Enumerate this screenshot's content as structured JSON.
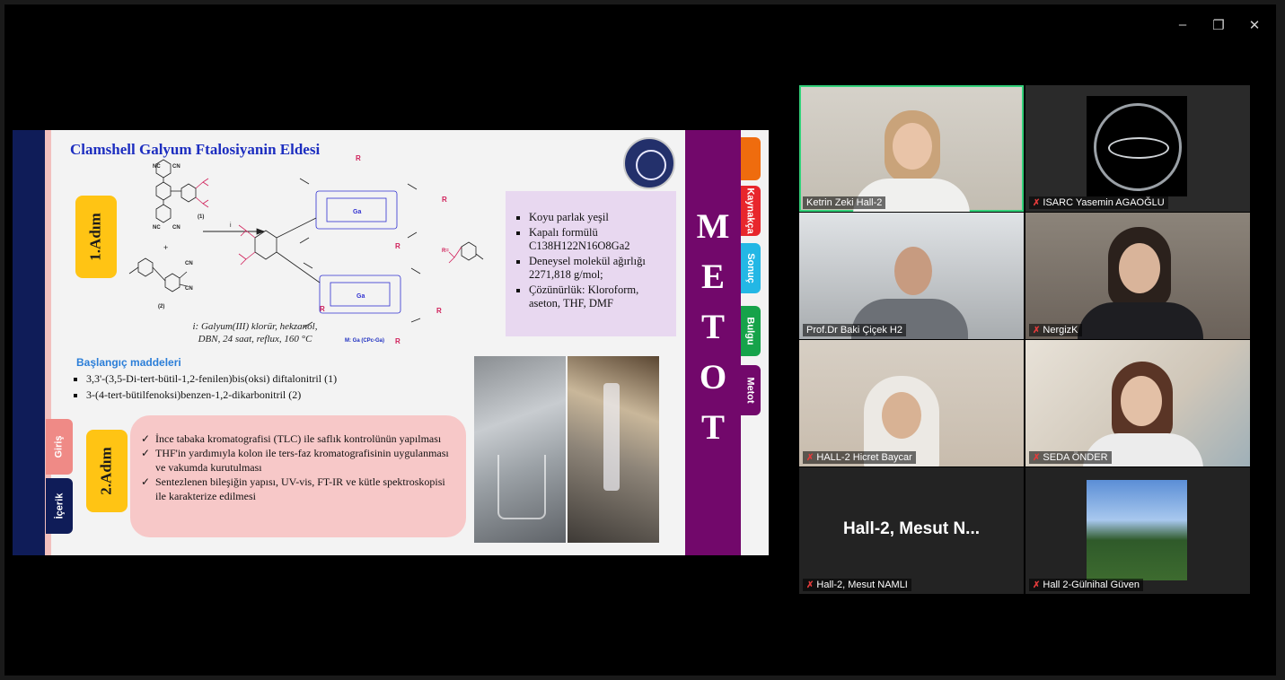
{
  "window": {
    "minimize_label": "–",
    "restore_label": "❐",
    "close_label": "✕"
  },
  "slide": {
    "title": "Clamshell Galyum Ftalosiyanin Eldesi",
    "step1_label": "1.Adım",
    "step2_label": "2.Adım",
    "scheme": {
      "cn": "CN",
      "nc": "NC",
      "r": "R",
      "r_eq": "R=",
      "ga": "Ga",
      "arrow_label": "i",
      "plus": "+",
      "cmpd1": "(1)",
      "cmpd2": "(2)"
    },
    "conditions_line1": "i: Galyum(III) klorür, hekzanol,",
    "conditions_line2": "DBN, 24 saat, reflux, 160 °C",
    "m_label": "M: Ga (CPc-Ga)",
    "properties": [
      "Koyu parlak yeşil",
      "Kapalı formülü C138H122N16O8Ga2",
      "Deneysel molekül ağırlığı 2271,818 g/mol;",
      "Çözünürlük: Kloroform, aseton, THF, DMF"
    ],
    "starting_heading": "Başlangıç maddeleri",
    "starting_items": [
      "3,3'-(3,5-Di-tert-bütil-1,2-fenilen)bis(oksi) diftalonitril (1)",
      "3-(4-tert-bütilfenoksi)benzen-1,2-dikarbonitril (2)"
    ],
    "step2_items": [
      "İnce tabaka kromatografisi (TLC) ile saflık kontrolünün yapılması",
      "THF'in yardımıyla kolon ile ters-faz kromatografisinin uygulanması ve vakumda kurutulması",
      "Sentezlenen bileşiğin yapısı, UV-vis, FT-IR ve kütle spektroskopisi ile karakterize edilmesi"
    ],
    "left_tabs": {
      "giris": "Giriş",
      "icerik": "İçerik"
    },
    "side_letters": [
      "M",
      "E",
      "T",
      "O",
      "T"
    ],
    "right_tabs": [
      "",
      "Kaynakça",
      "Sonuç",
      "Bulgu",
      "Metot"
    ],
    "colors": {
      "navy": "#0f1c58",
      "purple": "#72086b",
      "step_yellow": "#ffc414",
      "pink_box": "#f7c8c8",
      "info_box": "#e8d8f0",
      "tab_orange": "#ef6c0e",
      "tab_red": "#e8262c",
      "tab_cyan": "#23b7e5",
      "tab_green": "#16a34a",
      "tab_purple": "#72086b"
    }
  },
  "participants": [
    {
      "name": "Ketrin Zeki Hall-2",
      "muted": false,
      "active_speaker": true
    },
    {
      "name": "ISARC Yasemin AGAOĞLU",
      "muted": true,
      "active_speaker": false
    },
    {
      "name": "Prof.Dr Baki Çiçek  H2",
      "muted": false,
      "active_speaker": false
    },
    {
      "name": "NergizK",
      "muted": true,
      "active_speaker": false
    },
    {
      "name": "HALL-2 Hicret Baycar",
      "muted": true,
      "active_speaker": false
    },
    {
      "name": "SEDA ÖNDER",
      "muted": true,
      "active_speaker": false
    },
    {
      "name": "Hall-2, Mesut NAMLI",
      "muted": true,
      "active_speaker": false,
      "placeholder_name": "Hall-2, Mesut N..."
    },
    {
      "name": "Hall 2-Gülnihal Güven",
      "muted": true,
      "active_speaker": false
    }
  ]
}
